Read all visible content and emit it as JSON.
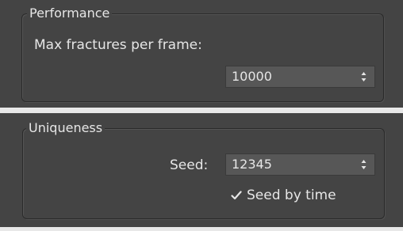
{
  "performance": {
    "title": "Performance",
    "max_fractures_label": "Max fractures per frame:",
    "max_fractures_value": "10000"
  },
  "uniqueness": {
    "title": "Uniqueness",
    "seed_label": "Seed:",
    "seed_value": "12345",
    "seed_by_time_label": "Seed by time",
    "seed_by_time_checked": true
  }
}
